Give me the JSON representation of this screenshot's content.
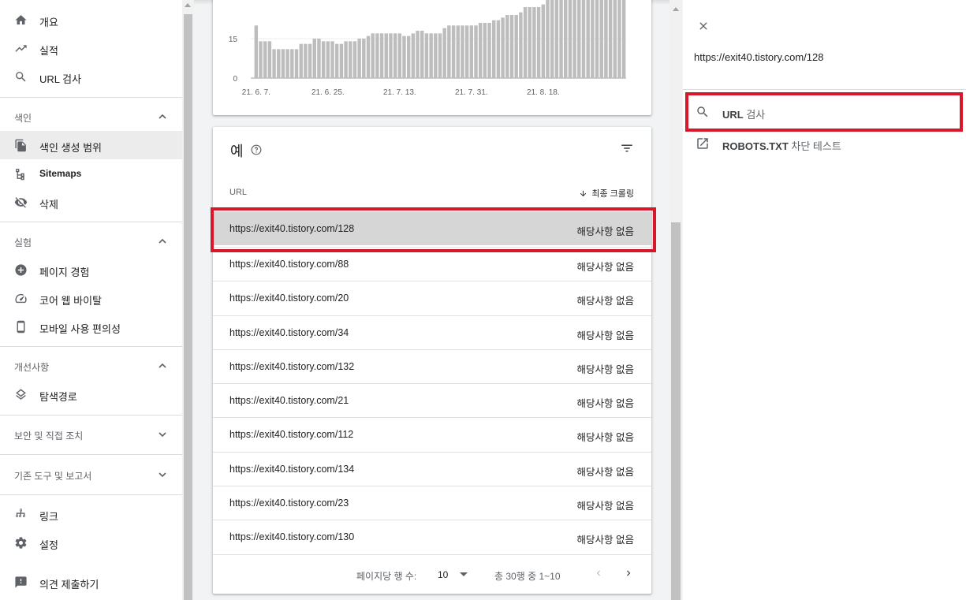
{
  "sidebar": {
    "items_top": [
      {
        "label": "개요",
        "icon": "home-icon"
      },
      {
        "label": "실적",
        "icon": "trending-up-icon"
      },
      {
        "label": "URL 검사",
        "icon": "search-icon"
      }
    ],
    "sections": {
      "index": {
        "title": "색인",
        "expanded": true,
        "items": [
          {
            "label": "색인 생성 범위",
            "icon": "file-copy-icon",
            "active": true
          },
          {
            "label": "Sitemaps",
            "icon": "sitemap-icon"
          },
          {
            "label": "삭제",
            "icon": "eye-off-icon"
          }
        ]
      },
      "experience": {
        "title": "실험",
        "expanded": true,
        "items": [
          {
            "label": "페이지 경험",
            "icon": "plus-circle-icon"
          },
          {
            "label": "코어 웹 바이탈",
            "icon": "speedometer-icon"
          },
          {
            "label": "모바일 사용 편의성",
            "icon": "phone-icon"
          }
        ]
      },
      "enhancements": {
        "title": "개선사항",
        "expanded": true,
        "items": [
          {
            "label": "탐색경로",
            "icon": "layers-icon"
          }
        ]
      },
      "security": {
        "title": "보안 및 직접 조치",
        "expanded": false
      },
      "legacy": {
        "title": "기존 도구 및 보고서",
        "expanded": false
      }
    },
    "items_bottom": [
      {
        "label": "링크",
        "icon": "links-icon"
      },
      {
        "label": "설정",
        "icon": "settings-icon"
      },
      {
        "label": "의견 제출하기",
        "icon": "feedback-icon"
      }
    ]
  },
  "chart_data": {
    "type": "bar",
    "ytick_labels": [
      "0",
      "15"
    ],
    "y_ticks": [
      0,
      15
    ],
    "ylim": [
      0,
      30
    ],
    "xtick_labels": [
      "21. 6. 7.",
      "21. 6. 25.",
      "21. 7. 13.",
      "21. 7. 31.",
      "21. 8. 18."
    ],
    "xtick_index": [
      0,
      16,
      32,
      48,
      64
    ],
    "values": [
      20,
      14,
      14,
      14,
      11,
      11,
      11,
      11,
      11,
      11,
      13,
      13,
      13,
      15,
      15,
      14,
      14,
      14,
      13,
      13,
      14,
      14,
      14,
      15,
      15,
      16,
      17,
      17,
      17,
      17,
      17,
      17,
      17,
      16,
      16,
      17,
      18,
      18,
      17,
      17,
      17,
      17,
      19,
      20,
      20,
      20,
      20,
      20,
      20,
      20,
      21,
      21,
      21,
      22,
      22,
      23,
      24,
      24,
      24,
      25,
      27,
      27,
      27,
      27,
      28,
      30,
      30,
      30,
      30,
      30,
      30,
      30,
      30,
      30,
      30,
      30,
      30,
      30,
      30,
      30,
      30,
      30,
      30
    ],
    "grid": true,
    "bar_color": "#bdbdbd"
  },
  "table": {
    "title": "예",
    "col_url": "URL",
    "col_crawl": "최종 크롤링",
    "rows": [
      {
        "url": "https://exit40.tistory.com/128",
        "crawl": "해당사항 없음"
      },
      {
        "url": "https://exit40.tistory.com/88",
        "crawl": "해당사항 없음"
      },
      {
        "url": "https://exit40.tistory.com/20",
        "crawl": "해당사항 없음"
      },
      {
        "url": "https://exit40.tistory.com/34",
        "crawl": "해당사항 없음"
      },
      {
        "url": "https://exit40.tistory.com/132",
        "crawl": "해당사항 없음"
      },
      {
        "url": "https://exit40.tistory.com/21",
        "crawl": "해당사항 없음"
      },
      {
        "url": "https://exit40.tistory.com/112",
        "crawl": "해당사항 없음"
      },
      {
        "url": "https://exit40.tistory.com/134",
        "crawl": "해당사항 없음"
      },
      {
        "url": "https://exit40.tistory.com/23",
        "crawl": "해당사항 없음"
      },
      {
        "url": "https://exit40.tistory.com/130",
        "crawl": "해당사항 없음"
      }
    ],
    "pager": {
      "rows_per_page_label": "페이지당 행 수:",
      "rows_per_page": "10",
      "range": "총 30행 중 1~10"
    }
  },
  "panel": {
    "url": "https://exit40.tistory.com/128",
    "action1_bold": "URL",
    "action1_rest": " 검사",
    "action2_bold": "ROBOTS.TXT",
    "action2_rest": " 차단 테스트"
  },
  "colors": {
    "highlight": "#d7182a",
    "selected_row": "#d6d6d6"
  }
}
